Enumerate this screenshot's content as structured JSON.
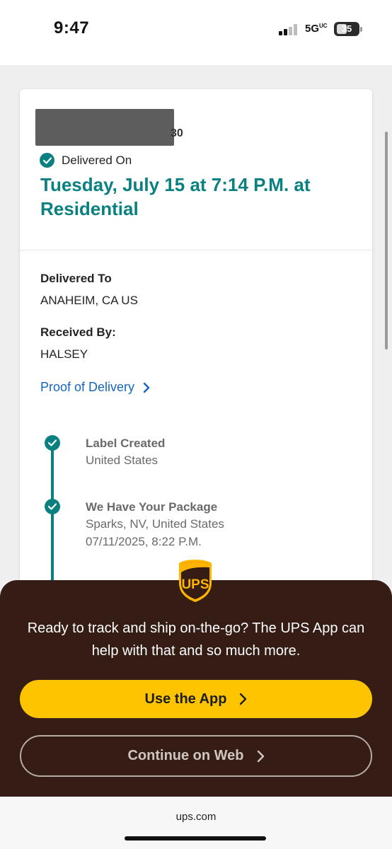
{
  "status_bar": {
    "time": "9:47",
    "network": "5G",
    "network_sup": "UC",
    "battery": "35"
  },
  "shipment": {
    "tracking_suffix": "30",
    "status_label": "Delivered On",
    "delivered_date": "Tuesday, July 15 at 7:14 P.M. at Residential",
    "delivered_to_label": "Delivered To",
    "delivered_to_value": "ANAHEIM, CA US",
    "received_by_label": "Received By:",
    "received_by_value": "HALSEY",
    "proof_link": "Proof of Delivery"
  },
  "timeline": [
    {
      "title": "Label Created",
      "location": "United States",
      "datetime": ""
    },
    {
      "title": "We Have Your Package",
      "location": "Sparks, NV, United States",
      "datetime": "07/11/2025, 8:22 P.M."
    }
  ],
  "app_sheet": {
    "logo_text": "UPS",
    "message": "Ready to track and ship on-the-go? The UPS App can help with that and so much more.",
    "primary_button": "Use the App",
    "secondary_button": "Continue on Web"
  },
  "browser": {
    "url": "ups.com"
  },
  "colors": {
    "accent_teal": "#0a8080",
    "link_blue": "#1565c0",
    "ups_brown": "#351c15",
    "ups_gold": "#ffc400"
  }
}
